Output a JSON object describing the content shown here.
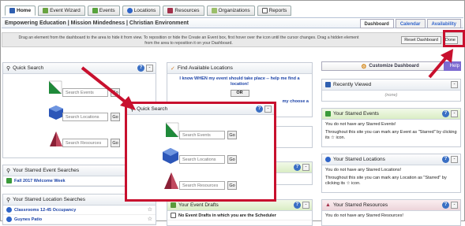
{
  "nav": {
    "tabs": [
      {
        "label": "Home",
        "icon": "home-icon"
      },
      {
        "label": "Event Wizard",
        "icon": "wizard-icon"
      },
      {
        "label": "Events",
        "icon": "events-icon"
      },
      {
        "label": "Locations",
        "icon": "locations-icon"
      },
      {
        "label": "Resources",
        "icon": "resources-icon"
      },
      {
        "label": "Organizations",
        "icon": "organizations-icon"
      },
      {
        "label": "Reports",
        "icon": "reports-icon"
      }
    ]
  },
  "header": {
    "title": "Empowering Education | Mission Mindedness | Christian Environment",
    "view_tabs": [
      "Dashboard",
      "Calendar",
      "Availability"
    ]
  },
  "instructions": {
    "text": "Drag an element from the dashboard to the area to hide it from view.  To reposition or hide the Create an Event box, first hover over the icon until the cursor changes.  Drag a hidden element from the area to reposition it on your Dashboard.",
    "reset_label": "Reset Dashboard",
    "done_label": "Done"
  },
  "quick_search": {
    "title": "Quick Search",
    "events_placeholder": "Search Events",
    "locations_placeholder": "Search Locations",
    "resources_placeholder": "Search Resources",
    "go_label": "Go"
  },
  "find_locations": {
    "title": "Find Available Locations",
    "line1": "I know WHEN my event should take place -- help me find a location!",
    "or": "OR",
    "line2_tail": "my choose a"
  },
  "customize": {
    "label": "Customize Dashboard",
    "help": "Help"
  },
  "recently_viewed": {
    "title": "Recently Viewed",
    "empty": "(none)"
  },
  "starred_events": {
    "title": "Your Starred Events",
    "line1": "You do not have any Starred Events!",
    "line2": "Throughout this site you can mark any Event as \"Starred\" by clicking its",
    "line2_tail": "icon."
  },
  "starred_locations": {
    "title": "Your Starred Locations",
    "line1": "You do not have any Starred Locations!",
    "line2": "Throughout this site you can mark any Location as \"Starred\" by clicking its",
    "line2_tail": "icon."
  },
  "starred_resources": {
    "title": "Your Starred Resources",
    "line1": "You do not have any Starred Resources!"
  },
  "starred_event_searches": {
    "title": "Your Starred Event Searches",
    "items": [
      "Fall 2017 Welcome Week"
    ]
  },
  "starred_location_searches": {
    "title": "Your Starred Location Searches",
    "items": [
      "Classrooms 12-45 Occupancy",
      "Guynes Patio"
    ]
  },
  "event_drafts": {
    "title": "Your Event Drafts",
    "line1": "No Event Drafts in which you are the Scheduler"
  },
  "colors": {
    "highlight": "#c8102e",
    "link": "#1d44a8",
    "help": "#7d6bd1"
  }
}
